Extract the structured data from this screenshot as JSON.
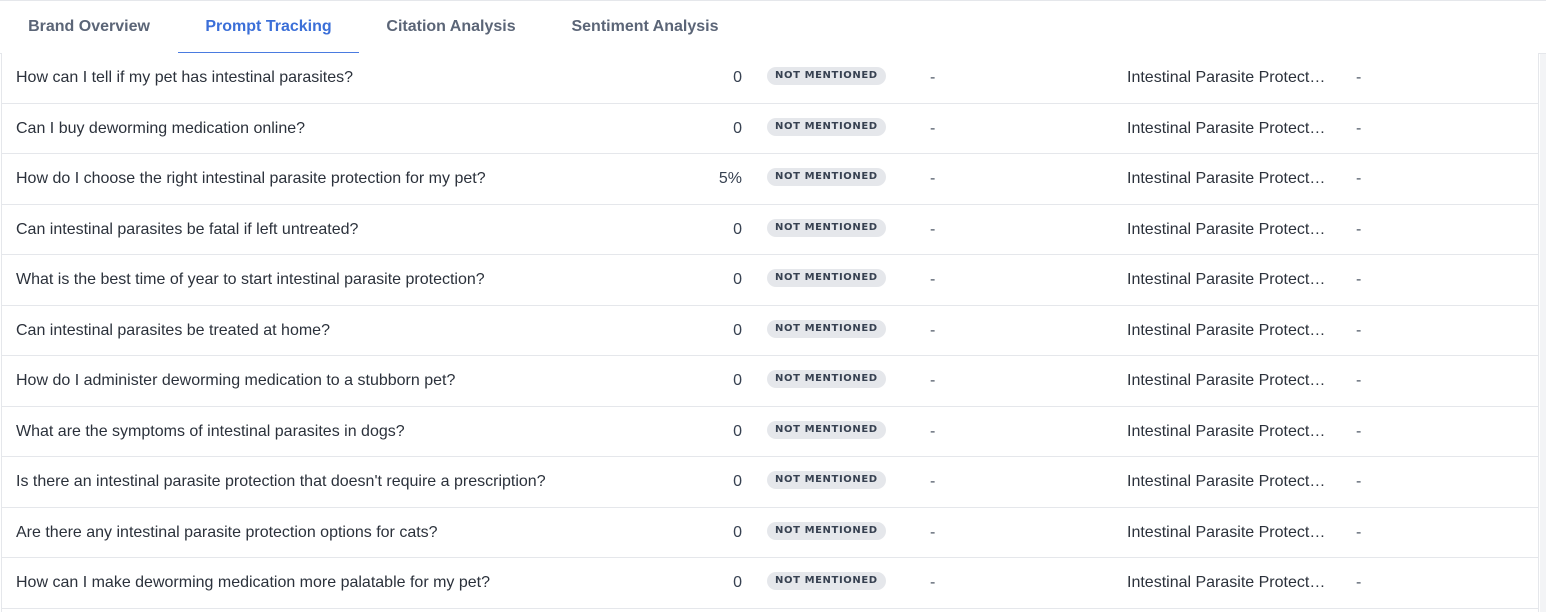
{
  "tabs": [
    {
      "label": "Brand Overview",
      "active": false
    },
    {
      "label": "Prompt Tracking",
      "active": true
    },
    {
      "label": "Citation Analysis",
      "active": false
    },
    {
      "label": "Sentiment Analysis",
      "active": false
    }
  ],
  "colors": {
    "accent": "#4a7be0",
    "badge_bg": "#e5e7eb",
    "border": "#e5e7eb"
  },
  "rows": [
    {
      "prompt": "How can I tell if my pet has intestinal parasites?",
      "score": "0",
      "status": "NOT MENTIONED",
      "position": "-",
      "topic": "Intestinal Parasite Protection",
      "extra": "-"
    },
    {
      "prompt": "Can I buy deworming medication online?",
      "score": "0",
      "status": "NOT MENTIONED",
      "position": "-",
      "topic": "Intestinal Parasite Protection",
      "extra": "-"
    },
    {
      "prompt": "How do I choose the right intestinal parasite protection for my pet?",
      "score": "5%",
      "status": "NOT MENTIONED",
      "position": "-",
      "topic": "Intestinal Parasite Protection",
      "extra": "-"
    },
    {
      "prompt": "Can intestinal parasites be fatal if left untreated?",
      "score": "0",
      "status": "NOT MENTIONED",
      "position": "-",
      "topic": "Intestinal Parasite Protection",
      "extra": "-"
    },
    {
      "prompt": "What is the best time of year to start intestinal parasite protection?",
      "score": "0",
      "status": "NOT MENTIONED",
      "position": "-",
      "topic": "Intestinal Parasite Protection",
      "extra": "-"
    },
    {
      "prompt": "Can intestinal parasites be treated at home?",
      "score": "0",
      "status": "NOT MENTIONED",
      "position": "-",
      "topic": "Intestinal Parasite Protection",
      "extra": "-"
    },
    {
      "prompt": "How do I administer deworming medication to a stubborn pet?",
      "score": "0",
      "status": "NOT MENTIONED",
      "position": "-",
      "topic": "Intestinal Parasite Protection",
      "extra": "-"
    },
    {
      "prompt": "What are the symptoms of intestinal parasites in dogs?",
      "score": "0",
      "status": "NOT MENTIONED",
      "position": "-",
      "topic": "Intestinal Parasite Protection",
      "extra": "-"
    },
    {
      "prompt": "Is there an intestinal parasite protection that doesn't require a prescription?",
      "score": "0",
      "status": "NOT MENTIONED",
      "position": "-",
      "topic": "Intestinal Parasite Protection",
      "extra": "-"
    },
    {
      "prompt": "Are there any intestinal parasite protection options for cats?",
      "score": "0",
      "status": "NOT MENTIONED",
      "position": "-",
      "topic": "Intestinal Parasite Protection",
      "extra": "-"
    },
    {
      "prompt": "How can I make deworming medication more palatable for my pet?",
      "score": "0",
      "status": "NOT MENTIONED",
      "position": "-",
      "topic": "Intestinal Parasite Protection",
      "extra": "-"
    }
  ]
}
